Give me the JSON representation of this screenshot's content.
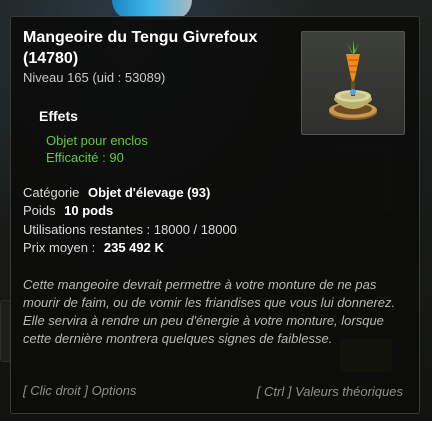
{
  "item": {
    "name_line1": "Mangeoire du Tengu Givrefoux",
    "name_line2": "(14780)",
    "level_line": "Niveau  165 (uid : 53089)",
    "icon": "carrot-feeder-icon"
  },
  "effects": {
    "title": "Effets",
    "lines": [
      "Objet pour enclos",
      "Efficacité : 90"
    ]
  },
  "properties": [
    {
      "label": "Catégorie",
      "value": "Objet d'élevage (93)"
    },
    {
      "label": "Poids",
      "value": "10 pods"
    },
    {
      "label": "Utilisations restantes : 18000 / 18000",
      "value": ""
    },
    {
      "label": "Prix moyen :",
      "value": "235 492 K"
    }
  ],
  "description": "Cette mangeoire devrait permettre à votre monture de ne pas mourir de faim, ou de vomir les friandises que vous lui donnerez. Elle servira à rendre un peu d'énergie à votre monture, lorsque cette dernière montrera quelques signes de faiblesse.",
  "footer": {
    "options": "[ Clic droit ] Options",
    "theory": "[ Ctrl ] Valeurs théoriques"
  },
  "colors": {
    "effect_green": "#5fcc3a",
    "panel_bg": "#0c0c0b"
  }
}
